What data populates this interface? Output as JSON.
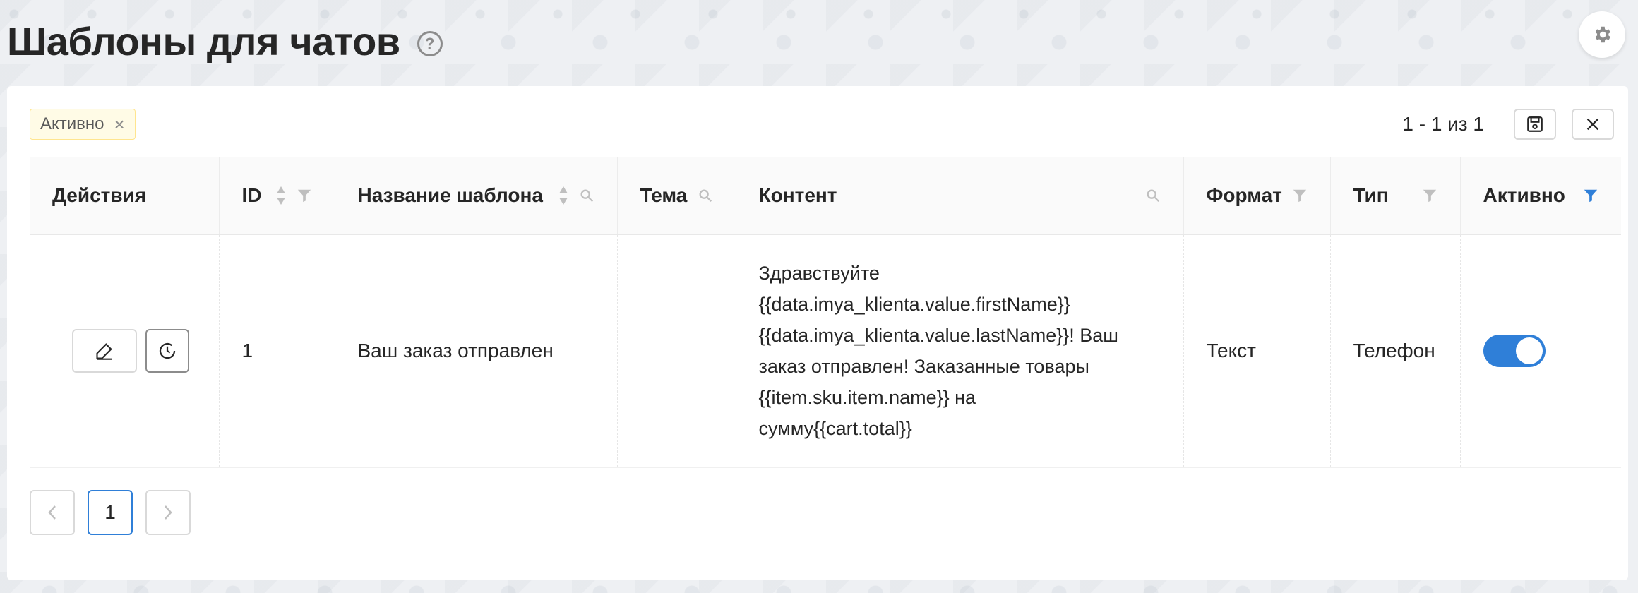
{
  "header": {
    "title": "Шаблоны для чатов",
    "help_icon": "question-circle-icon",
    "settings_icon": "gear-icon"
  },
  "filters": {
    "active_tag": "Активно"
  },
  "range": {
    "text": "1 - 1 из 1"
  },
  "table": {
    "columns": [
      {
        "label": "Действия",
        "sortable": false,
        "searchable": false,
        "filter": false
      },
      {
        "label": "ID",
        "sortable": true,
        "searchable": false,
        "filter": true
      },
      {
        "label": "Название шаблона",
        "sortable": true,
        "searchable": true,
        "filter": false
      },
      {
        "label": "Тема",
        "sortable": false,
        "searchable": true,
        "filter": false
      },
      {
        "label": "Контент",
        "sortable": false,
        "searchable": true,
        "filter": false
      },
      {
        "label": "Формат",
        "sortable": false,
        "searchable": false,
        "filter": true
      },
      {
        "label": "Тип",
        "sortable": false,
        "searchable": false,
        "filter": true
      },
      {
        "label": "Активно",
        "sortable": false,
        "searchable": false,
        "filter": true,
        "filter_active": true
      }
    ],
    "rows": [
      {
        "id": "1",
        "name": "Ваш заказ отправлен",
        "subject": "",
        "content_lines": [
          "Здравствуйте",
          "{{data.imya_klienta.value.firstName}}",
          "{{data.imya_klienta.value.lastName}}! Ваш",
          "заказ отправлен! Заказанные товары",
          "{{item.sku.item.name}} на",
          "сумму{{cart.total}}"
        ],
        "format": "Текст",
        "type": "Телефон",
        "active": true
      }
    ]
  },
  "pagination": {
    "current": "1"
  },
  "colors": {
    "accent": "#2f7fd8",
    "tag_bg": "#fffbe6",
    "tag_border": "#ffe58f"
  }
}
